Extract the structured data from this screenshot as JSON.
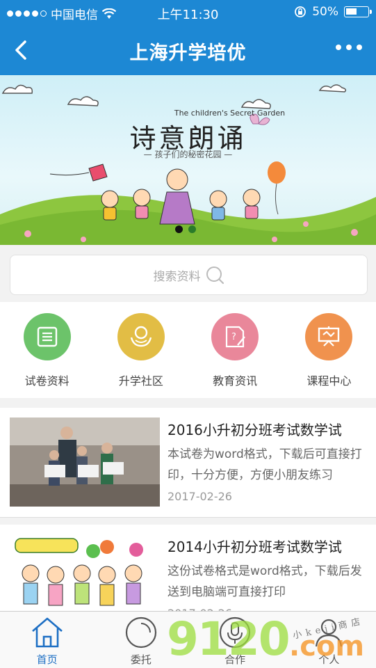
{
  "status_bar": {
    "carrier": "中国电信",
    "time": "上午11:30",
    "battery": "50%",
    "battery_level": 0.5
  },
  "nav": {
    "title": "上海升学培优",
    "back_icon": "chevron-left-icon",
    "more_icon": "more-dots-icon"
  },
  "banner": {
    "subtitle_en": "The children's Secret Garden",
    "title": "诗意朗诵",
    "subtitle": "— 孩子们的秘密花园 —",
    "pages": 2,
    "current_page": 1
  },
  "search": {
    "placeholder": "搜索资料"
  },
  "categories": [
    {
      "label": "试卷资料",
      "icon": "document-list-icon",
      "color": "#6cc36a"
    },
    {
      "label": "升学社区",
      "icon": "community-hands-icon",
      "color": "#e2bd45"
    },
    {
      "label": "教育资讯",
      "icon": "news-edit-icon",
      "color": "#e9879a"
    },
    {
      "label": "课程中心",
      "icon": "course-board-icon",
      "color": "#f0924e"
    }
  ],
  "articles": [
    {
      "title": "2016小升初分班考试数学试",
      "desc": "本试卷为word格式，下载后可直接打印，十分方便，方便小朋友练习",
      "date": "2017-02-26"
    },
    {
      "title": "2014小升初分班考试数学试",
      "desc": "这份试卷格式是word格式，下载后发送到电脑端可直接打印",
      "date": "2017-02-26"
    }
  ],
  "tabs": [
    {
      "label": "首页",
      "icon": "home-icon",
      "active": true
    },
    {
      "label": "委托",
      "icon": "circle-icon",
      "active": false
    },
    {
      "label": "合作",
      "icon": "microphone-icon",
      "active": false
    },
    {
      "label": "个人",
      "icon": "user-icon",
      "active": false
    }
  ],
  "watermark": {
    "number": "9120",
    "domain": ".com",
    "text": "小keji商店"
  },
  "colors": {
    "primary": "#1d88d4",
    "tab_active": "#1d6fc4"
  }
}
